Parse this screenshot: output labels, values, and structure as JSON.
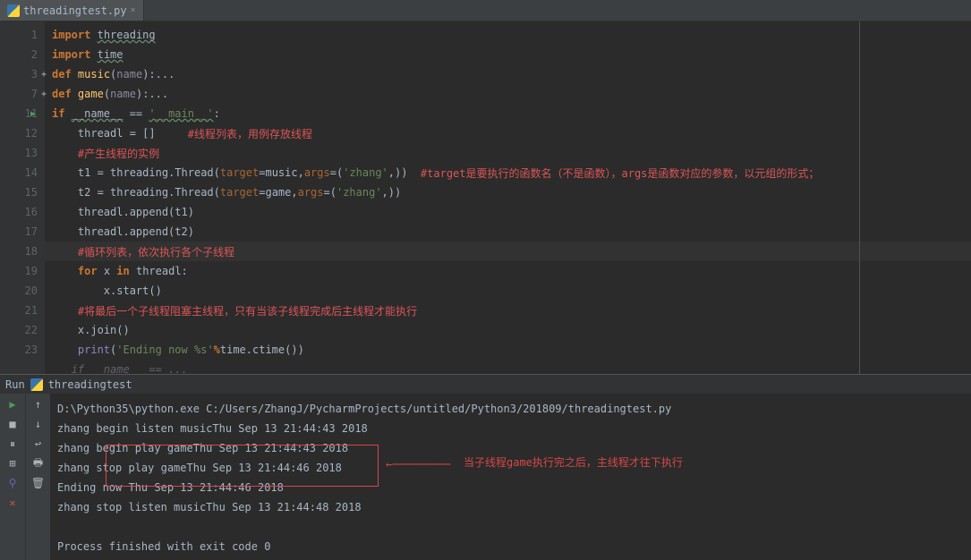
{
  "tab": {
    "filename": "threadingtest.py"
  },
  "gutter_lines": [
    "1",
    "2",
    "3",
    "7",
    "11",
    "12",
    "13",
    "14",
    "15",
    "16",
    "17",
    "18",
    "19",
    "20",
    "21",
    "22",
    "23"
  ],
  "code": {
    "import": "import",
    "threading": "threading",
    "time": "time",
    "def": "def",
    "music": "music",
    "game": "game",
    "name_param": "name",
    "collapsed": ":...",
    "if": "if",
    "dunder_name": "__name__",
    "eq": " == ",
    "dunder_main": "'__main__'",
    "colon": ":",
    "threadl": "threadl",
    "eq_bracket": " = []",
    "comment1": "#线程列表，用例存放线程",
    "comment2": "#产生线程的实例",
    "t1": "t1",
    "t2": "t2",
    "assign": " = ",
    "thread_cls": "threading.Thread(",
    "target": "target",
    "args": "args",
    "eq_k": "=",
    "zhang": "'zhang'",
    "comma_close": ",))",
    "comment3": "#target是要执行的函数名（不是函数），args是函数对应的参数，以元组的形式；",
    "append1": "threadl.append(t1)",
    "append2": "threadl.append(t2)",
    "comment4": "#循环列表，依次执行各个子线程",
    "for": "for",
    "x": "x",
    "in": "in",
    "threadl_colon": "threadl:",
    "xstart": "x.start()",
    "comment5": "#将最后一个子线程阻塞主线程，只有当该子线程完成后主线程才能执行",
    "xjoin": "x",
    "join_call": ".join()",
    "print": "print",
    "fmt_open": "(",
    "fmt_str": "'Ending now %s'",
    "pct": "%",
    "ctime": "time.ctime())",
    "hint": "if __name__ == ..."
  },
  "run": {
    "label": "Run",
    "config": "threadingtest",
    "lines": [
      "D:\\Python35\\python.exe C:/Users/ZhangJ/PycharmProjects/untitled/Python3/201809/threadingtest.py",
      "zhang begin listen musicThu Sep 13 21:44:43 2018",
      "zhang begin play gameThu Sep 13 21:44:43 2018",
      "zhang stop play gameThu Sep 13 21:44:46 2018",
      "Ending now Thu Sep 13 21:44:46 2018",
      "zhang stop listen musicThu Sep 13 21:44:48 2018",
      "",
      "Process finished with exit code 0"
    ],
    "annotation": "当子线程game执行完之后，主线程才往下执行"
  }
}
